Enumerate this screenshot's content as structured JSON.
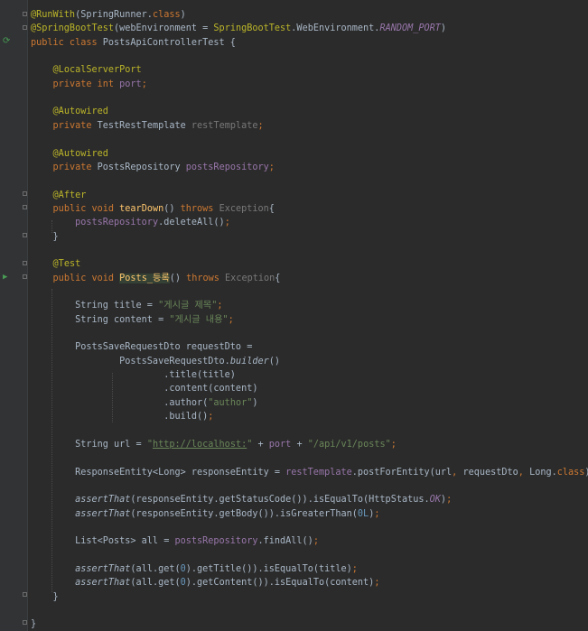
{
  "editor": {
    "lines": [
      {
        "tokens": [
          {
            "t": "@RunWith",
            "c": "ann"
          },
          {
            "t": "(SpringRunner."
          },
          {
            "t": "class",
            "c": "kw"
          },
          {
            "t": ")"
          }
        ]
      },
      {
        "tokens": [
          {
            "t": "@SpringBootTest",
            "c": "ann"
          },
          {
            "t": "(webEnvironment = "
          },
          {
            "t": "SpringBootTest",
            "c": "ann"
          },
          {
            "t": ".WebEnvironment."
          },
          {
            "t": "RANDOM_PORT",
            "c": "cst"
          },
          {
            "t": ")"
          }
        ]
      },
      {
        "tokens": [
          {
            "t": "public class ",
            "c": "kw"
          },
          {
            "t": "PostsApiControllerTest {"
          }
        ]
      },
      {
        "tokens": []
      },
      {
        "tokens": [
          {
            "t": "    "
          },
          {
            "t": "@LocalServerPort",
            "c": "ann"
          }
        ]
      },
      {
        "tokens": [
          {
            "t": "    "
          },
          {
            "t": "private int ",
            "c": "kw"
          },
          {
            "t": "port",
            "c": "fld"
          },
          {
            "t": ";",
            "c": "kw"
          }
        ]
      },
      {
        "tokens": []
      },
      {
        "tokens": [
          {
            "t": "    "
          },
          {
            "t": "@Autowired",
            "c": "ann"
          }
        ]
      },
      {
        "tokens": [
          {
            "t": "    "
          },
          {
            "t": "private ",
            "c": "kw"
          },
          {
            "t": "TestRestTemplate "
          },
          {
            "t": "restTemplate",
            "c": "unused"
          },
          {
            "t": ";",
            "c": "kw"
          }
        ]
      },
      {
        "tokens": []
      },
      {
        "tokens": [
          {
            "t": "    "
          },
          {
            "t": "@Autowired",
            "c": "ann"
          }
        ]
      },
      {
        "tokens": [
          {
            "t": "    "
          },
          {
            "t": "private ",
            "c": "kw"
          },
          {
            "t": "PostsRepository "
          },
          {
            "t": "postsRepository",
            "c": "fld"
          },
          {
            "t": ";",
            "c": "kw"
          }
        ]
      },
      {
        "tokens": []
      },
      {
        "tokens": [
          {
            "t": "    "
          },
          {
            "t": "@After",
            "c": "ann"
          }
        ]
      },
      {
        "tokens": [
          {
            "t": "    "
          },
          {
            "t": "public void ",
            "c": "kw"
          },
          {
            "t": "tearDown",
            "c": "mth"
          },
          {
            "t": "() "
          },
          {
            "t": "throws ",
            "c": "kw"
          },
          {
            "t": "Exception",
            "c": "unused"
          },
          {
            "t": "{"
          }
        ]
      },
      {
        "tokens": [
          {
            "t": "        "
          },
          {
            "t": "postsRepository",
            "c": "fld"
          },
          {
            "t": ".deleteAll()"
          },
          {
            "t": ";",
            "c": "kw"
          }
        ]
      },
      {
        "tokens": [
          {
            "t": "    }"
          }
        ]
      },
      {
        "tokens": []
      },
      {
        "tokens": [
          {
            "t": "    "
          },
          {
            "t": "@Test",
            "c": "ann"
          }
        ]
      },
      {
        "tokens": [
          {
            "t": "    "
          },
          {
            "t": "public void ",
            "c": "kw"
          },
          {
            "t": "Posts_등록",
            "c": "mth hl"
          },
          {
            "t": "() "
          },
          {
            "t": "throws ",
            "c": "kw"
          },
          {
            "t": "Exception",
            "c": "unused"
          },
          {
            "t": "{"
          }
        ]
      },
      {
        "tokens": []
      },
      {
        "tokens": [
          {
            "t": "        String title = "
          },
          {
            "t": "\"게시글 제목\"",
            "c": "str"
          },
          {
            "t": ";",
            "c": "kw"
          }
        ]
      },
      {
        "tokens": [
          {
            "t": "        String content = "
          },
          {
            "t": "\"게시글 내용\"",
            "c": "str"
          },
          {
            "t": ";",
            "c": "kw"
          }
        ]
      },
      {
        "tokens": []
      },
      {
        "tokens": [
          {
            "t": "        PostsSaveRequestDto requestDto ="
          }
        ]
      },
      {
        "tokens": [
          {
            "t": "                PostsSaveRequestDto."
          },
          {
            "t": "builder",
            "c": "itl"
          },
          {
            "t": "()"
          }
        ]
      },
      {
        "tokens": [
          {
            "t": "                        .title(title)"
          }
        ]
      },
      {
        "tokens": [
          {
            "t": "                        .content(content)"
          }
        ]
      },
      {
        "tokens": [
          {
            "t": "                        .author("
          },
          {
            "t": "\"author\"",
            "c": "str"
          },
          {
            "t": ")"
          }
        ]
      },
      {
        "tokens": [
          {
            "t": "                        .build()"
          },
          {
            "t": ";",
            "c": "kw"
          }
        ]
      },
      {
        "tokens": []
      },
      {
        "tokens": [
          {
            "t": "        String url = "
          },
          {
            "t": "\"",
            "c": "str"
          },
          {
            "t": "http://localhost:",
            "c": "url"
          },
          {
            "t": "\"",
            "c": "str"
          },
          {
            "t": " + "
          },
          {
            "t": "port",
            "c": "fld"
          },
          {
            "t": " + "
          },
          {
            "t": "\"/api/v1/posts\"",
            "c": "str"
          },
          {
            "t": ";",
            "c": "kw"
          }
        ]
      },
      {
        "tokens": []
      },
      {
        "tokens": [
          {
            "t": "        ResponseEntity<Long> responseEntity = "
          },
          {
            "t": "restTemplate",
            "c": "fld"
          },
          {
            "t": ".postForEntity(url"
          },
          {
            "t": ", ",
            "c": "kw"
          },
          {
            "t": "requestDto"
          },
          {
            "t": ", ",
            "c": "kw"
          },
          {
            "t": "Long."
          },
          {
            "t": "class",
            "c": "kw"
          },
          {
            "t": ")"
          },
          {
            "t": ";",
            "c": "kw"
          }
        ]
      },
      {
        "tokens": []
      },
      {
        "tokens": [
          {
            "t": "        "
          },
          {
            "t": "assertThat",
            "c": "itl"
          },
          {
            "t": "(responseEntity.getStatusCode()).isEqualTo(HttpStatus."
          },
          {
            "t": "OK",
            "c": "cst"
          },
          {
            "t": ")"
          },
          {
            "t": ";",
            "c": "kw"
          }
        ]
      },
      {
        "tokens": [
          {
            "t": "        "
          },
          {
            "t": "assertThat",
            "c": "itl"
          },
          {
            "t": "(responseEntity.getBody()).isGreaterThan("
          },
          {
            "t": "0L",
            "c": "num"
          },
          {
            "t": ")"
          },
          {
            "t": ";",
            "c": "kw"
          }
        ]
      },
      {
        "tokens": []
      },
      {
        "tokens": [
          {
            "t": "        List<Posts> all = "
          },
          {
            "t": "postsRepository",
            "c": "fld"
          },
          {
            "t": ".findAll()"
          },
          {
            "t": ";",
            "c": "kw"
          }
        ]
      },
      {
        "tokens": []
      },
      {
        "tokens": [
          {
            "t": "        "
          },
          {
            "t": "assertThat",
            "c": "itl"
          },
          {
            "t": "(all.get("
          },
          {
            "t": "0",
            "c": "num"
          },
          {
            "t": ").getTitle()).isEqualTo(title)"
          },
          {
            "t": ";",
            "c": "kw"
          }
        ]
      },
      {
        "tokens": [
          {
            "t": "        "
          },
          {
            "t": "assertThat",
            "c": "itl"
          },
          {
            "t": "(all.get("
          },
          {
            "t": "0",
            "c": "num"
          },
          {
            "t": ").getContent()).isEqualTo(content)"
          },
          {
            "t": ";",
            "c": "kw"
          }
        ]
      },
      {
        "tokens": [
          {
            "t": "    }"
          }
        ]
      },
      {
        "tokens": []
      },
      {
        "tokens": [
          {
            "t": "}"
          }
        ]
      }
    ]
  },
  "gutter": {
    "run_class_icon": "run-test-class-icon",
    "run_method_icon": "run-test-method-icon",
    "colors": {
      "background": "#2b2b2b",
      "keyword": "#cc7832",
      "annotation": "#bbb529",
      "field": "#9876aa",
      "string": "#6a8759",
      "method": "#ffc66d",
      "default": "#a9b7c6"
    }
  }
}
